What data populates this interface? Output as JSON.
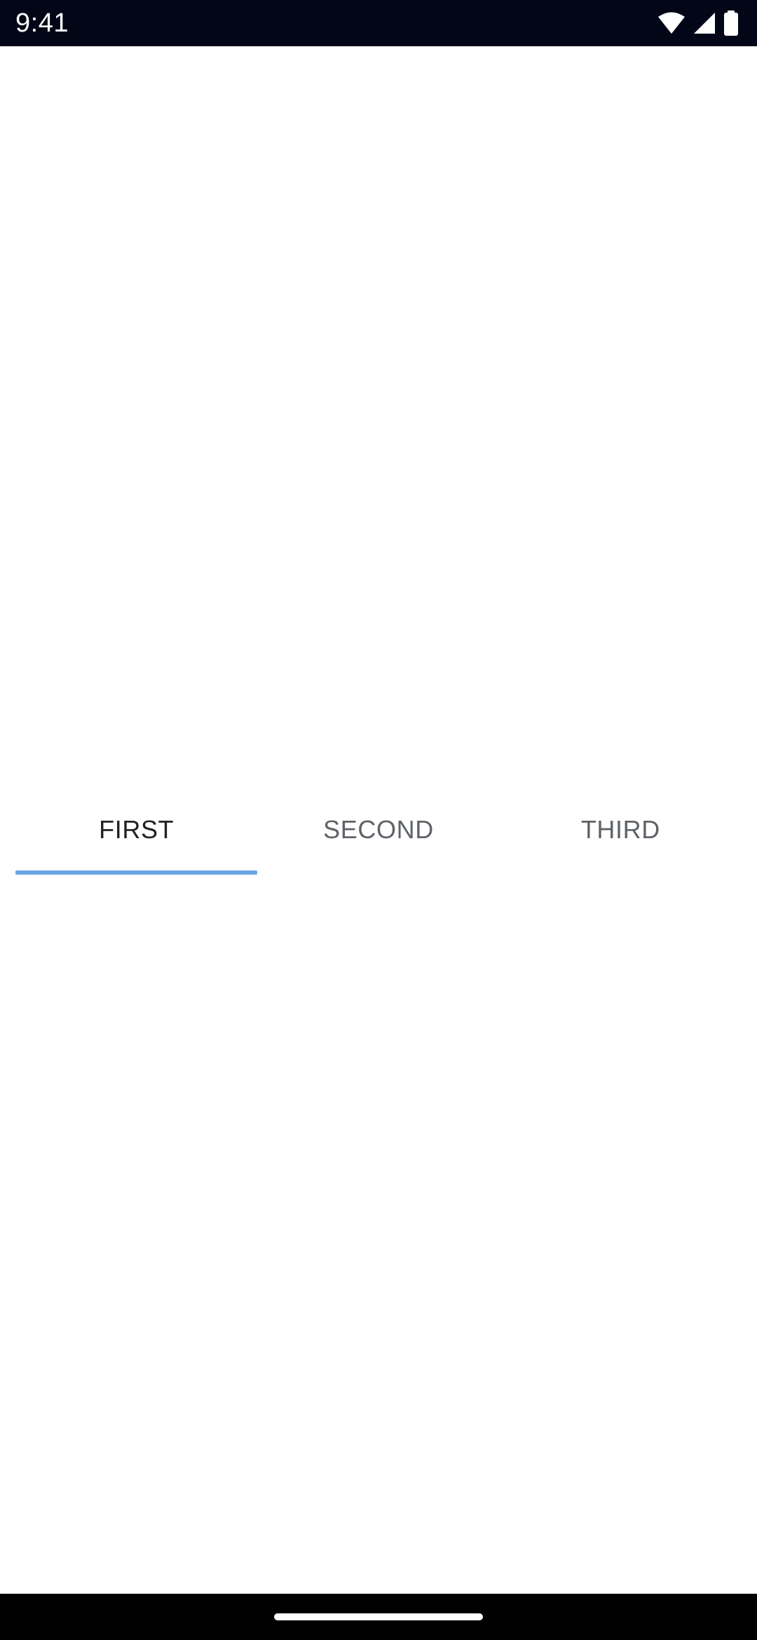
{
  "status_bar": {
    "time": "9:41",
    "icons": [
      "wifi-icon",
      "cellular-signal-icon",
      "battery-icon"
    ]
  },
  "tabs": [
    {
      "label": "FIRST",
      "selected": true
    },
    {
      "label": "SECOND",
      "selected": false
    },
    {
      "label": "THIRD",
      "selected": false
    }
  ],
  "colors": {
    "status_bar_bg": "#020617",
    "tab_indicator": "#6aa6e6",
    "tab_active_text": "#202124",
    "tab_inactive_text": "#5f6368",
    "nav_bar_bg": "#000000"
  }
}
